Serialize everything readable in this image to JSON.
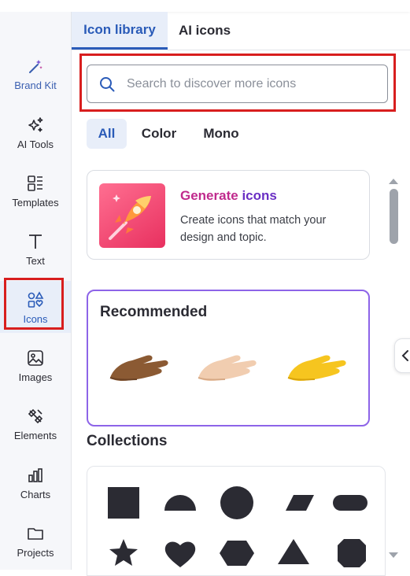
{
  "sidebar": {
    "items": [
      {
        "label": "Brand Kit",
        "icon": "magic-wand-icon"
      },
      {
        "label": "AI Tools",
        "icon": "sparkles-icon"
      },
      {
        "label": "Templates",
        "icon": "templates-icon"
      },
      {
        "label": "Text",
        "icon": "text-t-icon"
      },
      {
        "label": "Icons",
        "icon": "shapes-icon"
      },
      {
        "label": "Images",
        "icon": "image-icon"
      },
      {
        "label": "Elements",
        "icon": "elements-icon"
      },
      {
        "label": "Charts",
        "icon": "bar-chart-icon"
      },
      {
        "label": "Projects",
        "icon": "folder-icon"
      }
    ],
    "active": "Icons"
  },
  "tabs": [
    {
      "label": "Icon library",
      "active": true
    },
    {
      "label": "AI icons",
      "active": false
    }
  ],
  "search": {
    "placeholder": "Search to discover more icons",
    "value": ""
  },
  "filters": [
    {
      "label": "All",
      "active": true
    },
    {
      "label": "Color",
      "active": false
    },
    {
      "label": "Mono",
      "active": false
    }
  ],
  "generate": {
    "title_part1": "Generate",
    "title_part2": "icons",
    "description": "Create icons that match your design and topic."
  },
  "recommended": {
    "title": "Recommended"
  },
  "collections": {
    "title": "Collections"
  },
  "colors": {
    "accent": "#2a5bb8",
    "highlight": "#d81e1e",
    "recommended_border": "#8d64e8",
    "shape_fill": "#2b2b33"
  }
}
